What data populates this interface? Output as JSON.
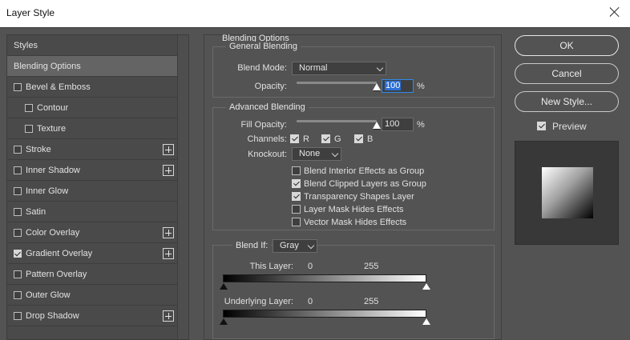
{
  "window": {
    "title": "Layer Style"
  },
  "sidebar": {
    "items": [
      {
        "label": "Styles",
        "checkbox": false,
        "checked": false,
        "indent": 0,
        "plus": false,
        "selected": false
      },
      {
        "label": "Blending Options",
        "checkbox": false,
        "checked": false,
        "indent": 0,
        "plus": false,
        "selected": true
      },
      {
        "label": "Bevel & Emboss",
        "checkbox": true,
        "checked": false,
        "indent": 0,
        "plus": false,
        "selected": false
      },
      {
        "label": "Contour",
        "checkbox": true,
        "checked": false,
        "indent": 1,
        "plus": false,
        "selected": false
      },
      {
        "label": "Texture",
        "checkbox": true,
        "checked": false,
        "indent": 1,
        "plus": false,
        "selected": false
      },
      {
        "label": "Stroke",
        "checkbox": true,
        "checked": false,
        "indent": 0,
        "plus": true,
        "selected": false
      },
      {
        "label": "Inner Shadow",
        "checkbox": true,
        "checked": false,
        "indent": 0,
        "plus": true,
        "selected": false
      },
      {
        "label": "Inner Glow",
        "checkbox": true,
        "checked": false,
        "indent": 0,
        "plus": false,
        "selected": false
      },
      {
        "label": "Satin",
        "checkbox": true,
        "checked": false,
        "indent": 0,
        "plus": false,
        "selected": false
      },
      {
        "label": "Color Overlay",
        "checkbox": true,
        "checked": false,
        "indent": 0,
        "plus": true,
        "selected": false
      },
      {
        "label": "Gradient Overlay",
        "checkbox": true,
        "checked": true,
        "indent": 0,
        "plus": true,
        "selected": false
      },
      {
        "label": "Pattern Overlay",
        "checkbox": true,
        "checked": false,
        "indent": 0,
        "plus": false,
        "selected": false
      },
      {
        "label": "Outer Glow",
        "checkbox": true,
        "checked": false,
        "indent": 0,
        "plus": false,
        "selected": false
      },
      {
        "label": "Drop Shadow",
        "checkbox": true,
        "checked": false,
        "indent": 0,
        "plus": true,
        "selected": false
      }
    ]
  },
  "blending": {
    "title": "Blending Options",
    "general": {
      "title": "General Blending",
      "blend_mode_label": "Blend Mode:",
      "blend_mode_value": "Normal",
      "opacity_label": "Opacity:",
      "opacity_value": "100",
      "opacity_unit": "%",
      "opacity_level": 1.0
    },
    "advanced": {
      "title": "Advanced Blending",
      "fill_opacity_label": "Fill Opacity:",
      "fill_opacity_value": "100",
      "fill_opacity_unit": "%",
      "fill_opacity_level": 1.0,
      "channels_label": "Channels:",
      "channels": [
        {
          "label": "R",
          "checked": true
        },
        {
          "label": "G",
          "checked": true
        },
        {
          "label": "B",
          "checked": true
        }
      ],
      "knockout_label": "Knockout:",
      "knockout_value": "None",
      "options": [
        {
          "label": "Blend Interior Effects as Group",
          "checked": false
        },
        {
          "label": "Blend Clipped Layers as Group",
          "checked": true
        },
        {
          "label": "Transparency Shapes Layer",
          "checked": true
        },
        {
          "label": "Layer Mask Hides Effects",
          "checked": false
        },
        {
          "label": "Vector Mask Hides Effects",
          "checked": false
        }
      ]
    },
    "blend_if": {
      "label": "Blend If:",
      "value": "Gray",
      "this_layer": {
        "label": "This Layer:",
        "low": "0",
        "high": "255"
      },
      "underlying_layer": {
        "label": "Underlying Layer:",
        "low": "0",
        "high": "255"
      }
    }
  },
  "buttons": {
    "ok": "OK",
    "cancel": "Cancel",
    "new_style": "New Style..."
  },
  "preview": {
    "label": "Preview",
    "checked": true
  }
}
